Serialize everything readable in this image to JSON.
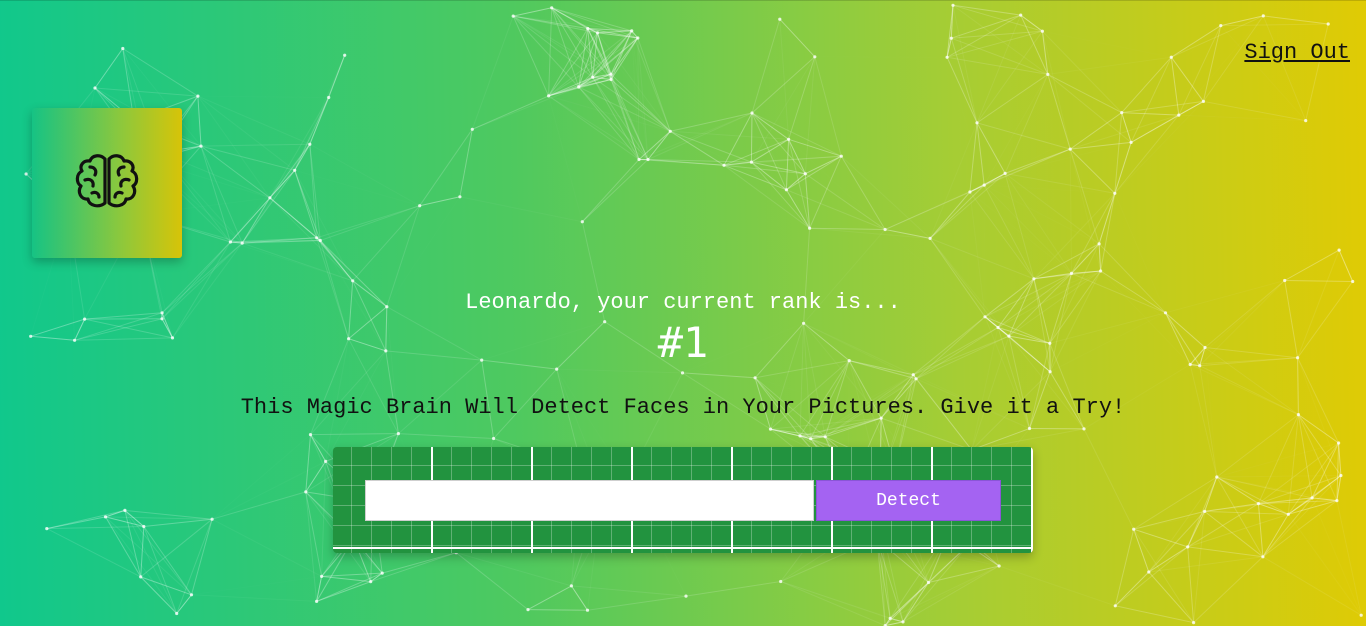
{
  "nav": {
    "signout_label": "Sign Out"
  },
  "logo": {
    "icon": "brain-icon"
  },
  "rank": {
    "greeting": "Leonardo, your current rank is...",
    "value": "#1"
  },
  "tagline": "This Magic Brain Will Detect Faces in Your Pictures. Give it a Try!",
  "form": {
    "input_value": "",
    "detect_label": "Detect"
  },
  "colors": {
    "gradient_start": "#10c88c",
    "gradient_end": "#e0cb04",
    "panel_green": "#22933f",
    "button_purple": "#a463f2"
  }
}
